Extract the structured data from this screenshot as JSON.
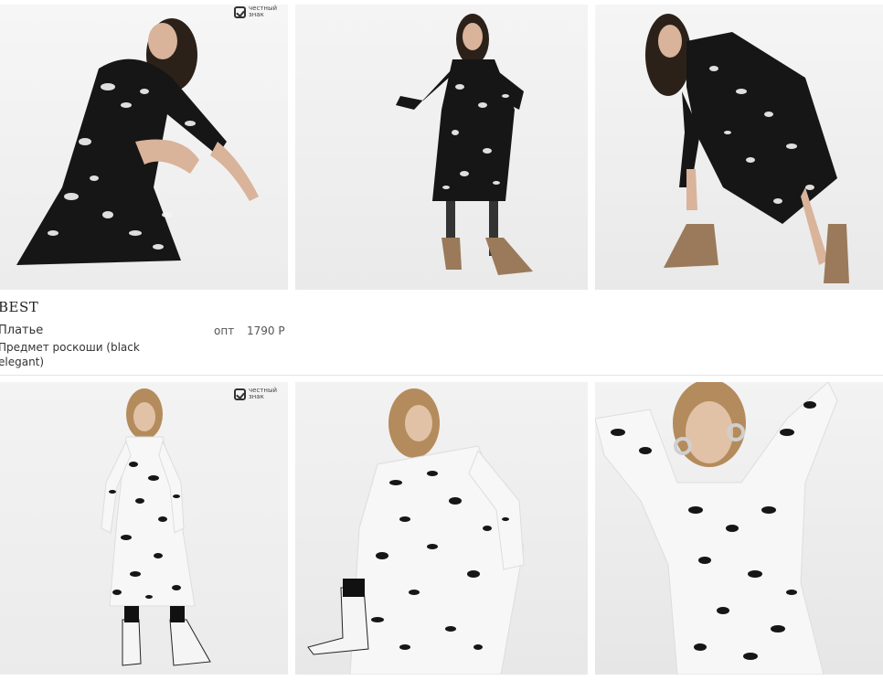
{
  "badge": {
    "line1": "честный",
    "line2": "знак"
  },
  "product": {
    "brand": "BEST",
    "name": "Платье",
    "description": "Предмет роскоши (black elegant)",
    "price_type": "опт",
    "price": "1790 Р"
  },
  "photos": [
    {
      "pose": "crouching",
      "dress_color": "black with white floral"
    },
    {
      "pose": "standing",
      "dress_color": "black with white floral"
    },
    {
      "pose": "leaning",
      "dress_color": "black with white floral"
    },
    {
      "pose": "standing",
      "dress_color": "white with black floral"
    },
    {
      "pose": "sitting",
      "dress_color": "white with black floral"
    },
    {
      "pose": "close-up",
      "dress_color": "white with black floral"
    }
  ]
}
